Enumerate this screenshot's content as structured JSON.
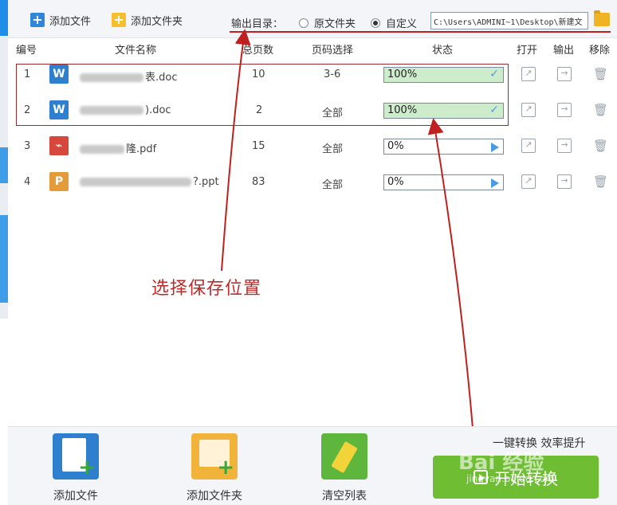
{
  "toolbar": {
    "add_file": "添加文件",
    "add_folder": "添加文件夹",
    "output_dir_label": "输出目录：",
    "radio_original": "原文件夹",
    "radio_custom": "自定义",
    "path_value": "C:\\Users\\ADMINI~1\\Desktop\\新建文"
  },
  "table": {
    "headers": [
      "编号",
      "文件名称",
      "总页数",
      "页码选择",
      "状态",
      "打开",
      "输出",
      "移除"
    ],
    "rows": [
      {
        "num": "1",
        "icon": "W",
        "name_suffix": "表.doc",
        "pages": "10",
        "range": "3-6",
        "status": "100%",
        "done": true
      },
      {
        "num": "2",
        "icon": "W",
        "name_suffix": ").doc",
        "pages": "2",
        "range": "全部",
        "status": "100%",
        "done": true
      },
      {
        "num": "3",
        "icon": "pdf",
        "name_suffix": "隆.pdf",
        "pages": "15",
        "range": "全部",
        "status": "0%",
        "done": false
      },
      {
        "num": "4",
        "icon": "P",
        "name_suffix": "?.ppt",
        "pages": "83",
        "range": "全部",
        "status": "0%",
        "done": false
      }
    ]
  },
  "annotation": "选择保存位置",
  "bottom": {
    "add_file": "添加文件",
    "add_folder": "添加文件夹",
    "clear_list": "清空列表",
    "slogan": "一键转换  效率提升",
    "start": "开始转换"
  },
  "watermark": {
    "main": "Bai 经验",
    "sub": "jingyan.baidu.com"
  },
  "colors": {
    "accent_blue": "#2f87d8",
    "progress_fill": "#cdeccc",
    "start_green": "#6ebd33",
    "annotation_red": "#c02a2a"
  }
}
